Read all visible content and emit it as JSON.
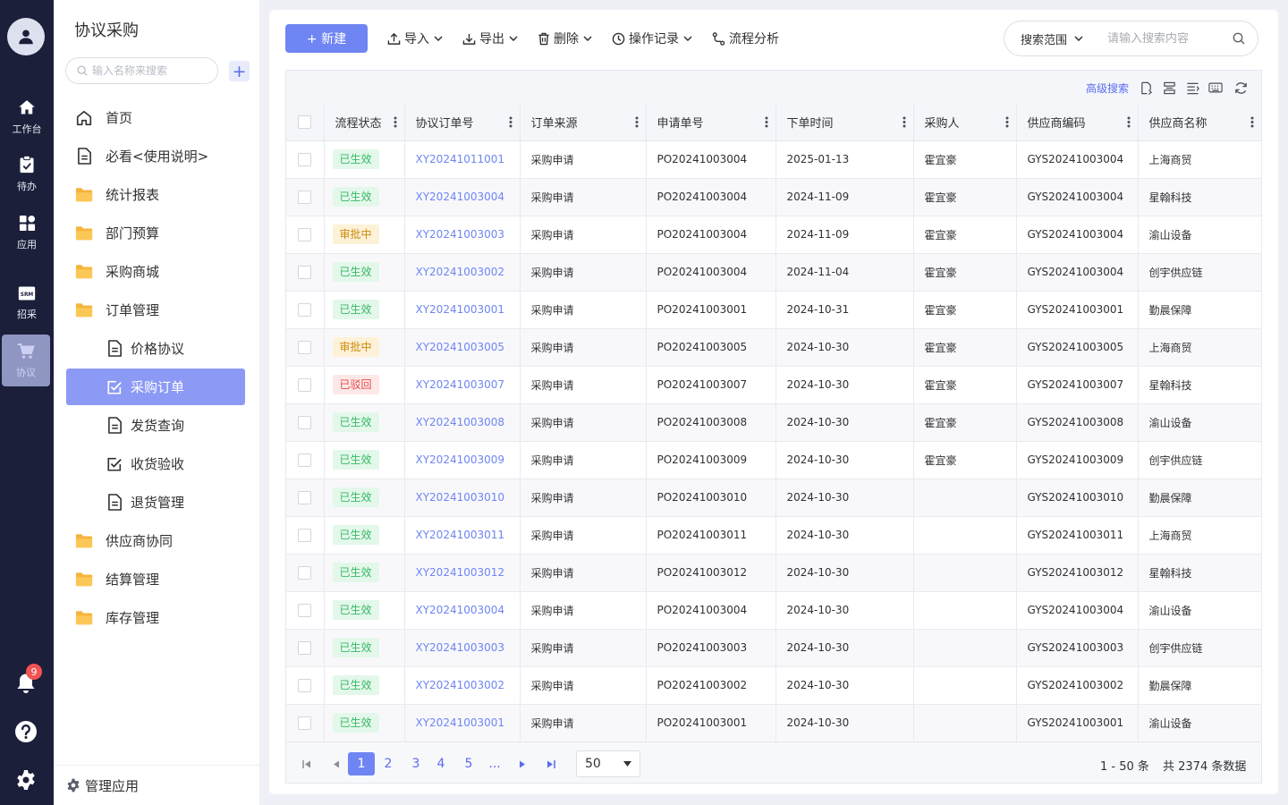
{
  "rail": {
    "items": [
      {
        "label": "工作台",
        "icon": "home-icon"
      },
      {
        "label": "待办",
        "icon": "clipboard-check-icon"
      },
      {
        "label": "应用",
        "icon": "apps-grid-icon"
      },
      {
        "label": "招采",
        "icon": "srm-icon",
        "icon_text": "SRM"
      },
      {
        "label": "协议",
        "icon": "cart-icon",
        "active": true
      }
    ],
    "notifications": "9"
  },
  "menu": {
    "title": "协议采购",
    "search_placeholder": "输入名称来搜索",
    "add": "+",
    "items": [
      {
        "label": "首页",
        "icon": "home-outline-icon",
        "level": 1
      },
      {
        "label": "必看<使用说明>",
        "icon": "document-icon",
        "level": 1
      },
      {
        "label": "统计报表",
        "icon": "folder-icon",
        "level": 1
      },
      {
        "label": "部门预算",
        "icon": "folder-icon",
        "level": 1
      },
      {
        "label": "采购商城",
        "icon": "folder-icon",
        "level": 1
      },
      {
        "label": "订单管理",
        "icon": "folder-icon",
        "level": 1
      },
      {
        "label": "价格协议",
        "icon": "document-icon",
        "level": 2
      },
      {
        "label": "采购订单",
        "icon": "checkbox-doc-icon",
        "level": 2,
        "active": true
      },
      {
        "label": "发货查询",
        "icon": "document-icon",
        "level": 2
      },
      {
        "label": "收货验收",
        "icon": "checkbox-doc-icon",
        "level": 2
      },
      {
        "label": "退货管理",
        "icon": "document-icon",
        "level": 2
      },
      {
        "label": "供应商协同",
        "icon": "folder-icon",
        "level": 1
      },
      {
        "label": "结算管理",
        "icon": "folder-icon",
        "level": 1
      },
      {
        "label": "库存管理",
        "icon": "folder-icon",
        "level": 1
      }
    ],
    "footer": "管理应用"
  },
  "toolbar": {
    "new_label": "+ 新建",
    "import_label": "导入",
    "export_label": "导出",
    "delete_label": "删除",
    "log_label": "操作记录",
    "flow_label": "流程分析",
    "search_scope": "搜索范围",
    "search_placeholder": "请输入搜索内容"
  },
  "grid": {
    "advanced_search": "高级搜索",
    "columns": [
      "流程状态",
      "协议订单号",
      "订单来源",
      "申请单号",
      "下单时间",
      "采购人",
      "供应商编码",
      "供应商名称"
    ],
    "rows": [
      [
        "已生效",
        "XY20241011001",
        "采购申请",
        "PO20241003004",
        "2025-01-13",
        "霍宜豪",
        "GYS20241003004",
        "上海商贸"
      ],
      [
        "已生效",
        "XY20241003004",
        "采购申请",
        "PO20241003004",
        "2024-11-09",
        "霍宜豪",
        "GYS20241003004",
        "星翰科技"
      ],
      [
        "审批中",
        "XY20241003003",
        "采购申请",
        "PO20241003004",
        "2024-11-09",
        "霍宜豪",
        "GYS20241003004",
        "渝山设备"
      ],
      [
        "已生效",
        "XY20241003002",
        "采购申请",
        "PO20241003004",
        "2024-11-04",
        "霍宜豪",
        "GYS20241003004",
        "创宇供应链"
      ],
      [
        "已生效",
        "XY20241003001",
        "采购申请",
        "PO20241003001",
        "2024-10-31",
        "霍宜豪",
        "GYS20241003001",
        "勤晨保障"
      ],
      [
        "审批中",
        "XY20241003005",
        "采购申请",
        "PO20241003005",
        "2024-10-30",
        "霍宜豪",
        "GYS20241003005",
        "上海商贸"
      ],
      [
        "已驳回",
        "XY20241003007",
        "采购申请",
        "PO20241003007",
        "2024-10-30",
        "霍宜豪",
        "GYS20241003007",
        "星翰科技"
      ],
      [
        "已生效",
        "XY20241003008",
        "采购申请",
        "PO20241003008",
        "2024-10-30",
        "霍宜豪",
        "GYS20241003008",
        "渝山设备"
      ],
      [
        "已生效",
        "XY20241003009",
        "采购申请",
        "PO20241003009",
        "2024-10-30",
        "霍宜豪",
        "GYS20241003009",
        "创宇供应链"
      ],
      [
        "已生效",
        "XY20241003010",
        "采购申请",
        "PO20241003010",
        "2024-10-30",
        "",
        "GYS20241003010",
        "勤晨保障"
      ],
      [
        "已生效",
        "XY20241003011",
        "采购申请",
        "PO20241003011",
        "2024-10-30",
        "",
        "GYS20241003011",
        "上海商贸"
      ],
      [
        "已生效",
        "XY20241003012",
        "采购申请",
        "PO20241003012",
        "2024-10-30",
        "",
        "GYS20241003012",
        "星翰科技"
      ],
      [
        "已生效",
        "XY20241003004",
        "采购申请",
        "PO20241003004",
        "2024-10-30",
        "",
        "GYS20241003004",
        "渝山设备"
      ],
      [
        "已生效",
        "XY20241003003",
        "采购申请",
        "PO20241003003",
        "2024-10-30",
        "",
        "GYS20241003003",
        "创宇供应链"
      ],
      [
        "已生效",
        "XY20241003002",
        "采购申请",
        "PO20241003002",
        "2024-10-30",
        "",
        "GYS20241003002",
        "勤晨保障"
      ],
      [
        "已生效",
        "XY20241003001",
        "采购申请",
        "PO20241003001",
        "2024-10-30",
        "",
        "GYS20241003001",
        "渝山设备"
      ]
    ]
  },
  "pagination": {
    "pages": [
      "1",
      "2",
      "3",
      "4",
      "5",
      "..."
    ],
    "current": "1",
    "page_size": "50",
    "range": "1 - 50 条",
    "total": "共 2374 条数据"
  },
  "colors": {
    "primary": "#6f85f3",
    "rail_bg": "#1b1f3a",
    "menu_active": "#8c9af5",
    "status_active": "#39b866",
    "status_pending": "#cc8a0a",
    "status_rejected": "#e24a4a"
  }
}
